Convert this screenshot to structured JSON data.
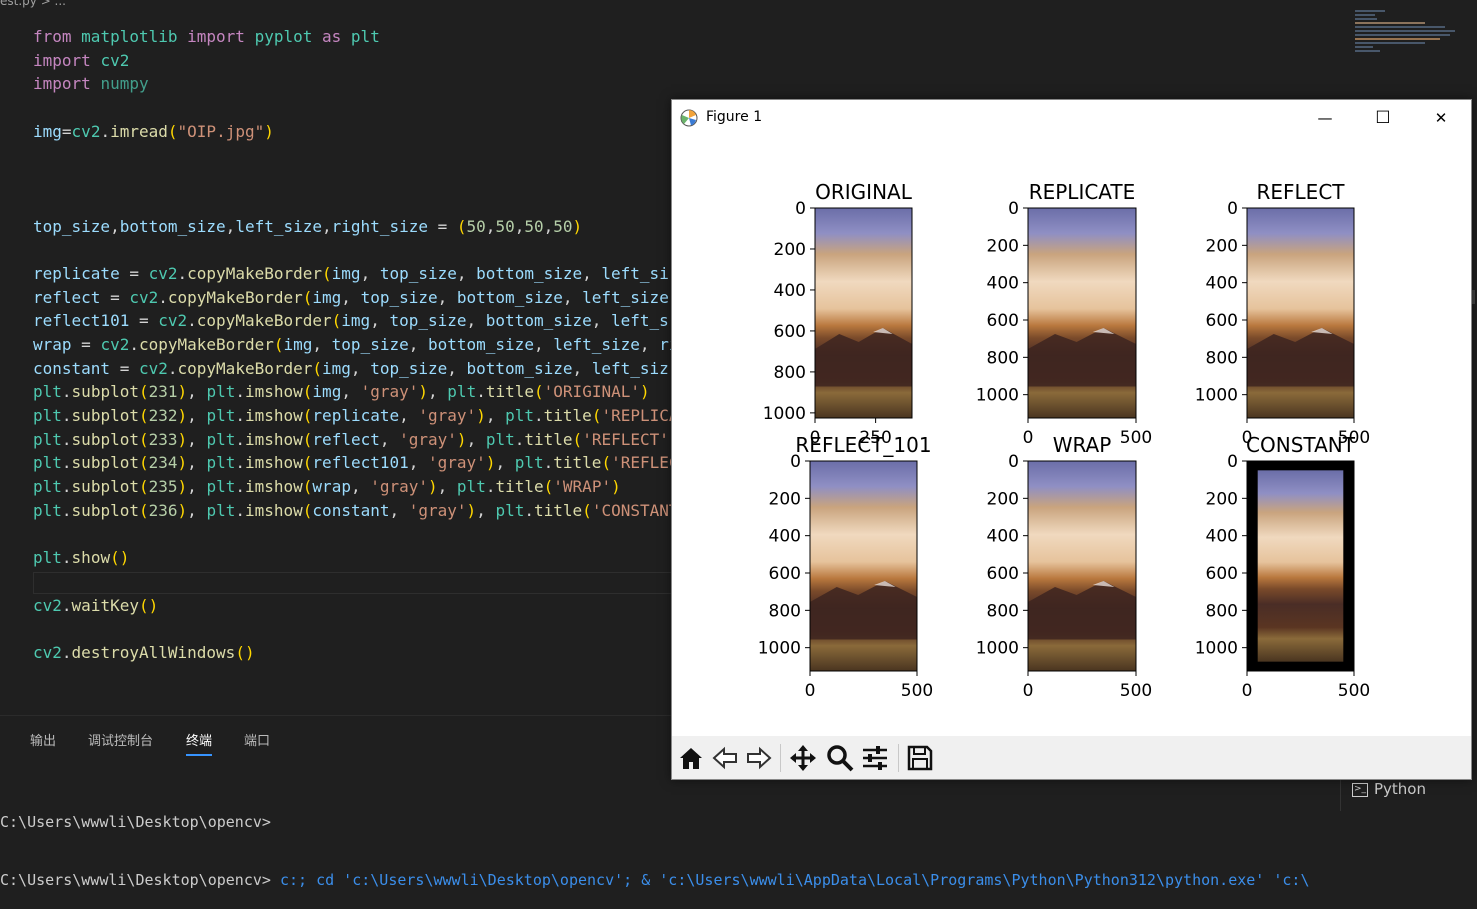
{
  "editor": {
    "breadcrumb": "est.py > ...",
    "code_lines": [
      [
        {
          "t": "from",
          "c": "kw"
        },
        {
          "t": " "
        },
        {
          "t": "matplotlib",
          "c": "mod"
        },
        {
          "t": " "
        },
        {
          "t": "import",
          "c": "kw"
        },
        {
          "t": " "
        },
        {
          "t": "pyplot",
          "c": "mod"
        },
        {
          "t": " "
        },
        {
          "t": "as",
          "c": "kw"
        },
        {
          "t": " "
        },
        {
          "t": "plt",
          "c": "mod"
        }
      ],
      [
        {
          "t": "import",
          "c": "kw"
        },
        {
          "t": " "
        },
        {
          "t": "cv2",
          "c": "mod"
        }
      ],
      [
        {
          "t": "import",
          "c": "kw"
        },
        {
          "t": " "
        },
        {
          "t": "numpy",
          "c": "mod2"
        }
      ],
      [],
      [
        {
          "t": "img",
          "c": "var"
        },
        {
          "t": "="
        },
        {
          "t": "cv2",
          "c": "mod"
        },
        {
          "t": "."
        },
        {
          "t": "imread",
          "c": "fn"
        },
        {
          "t": "(",
          "c": "paren"
        },
        {
          "t": "\"OIP.jpg\"",
          "c": "str"
        },
        {
          "t": ")",
          "c": "paren"
        }
      ],
      [],
      [],
      [],
      [
        {
          "t": "top_size",
          "c": "var"
        },
        {
          "t": ","
        },
        {
          "t": "bottom_size",
          "c": "var"
        },
        {
          "t": ","
        },
        {
          "t": "left_size",
          "c": "var"
        },
        {
          "t": ","
        },
        {
          "t": "right_size",
          "c": "var"
        },
        {
          "t": " = "
        },
        {
          "t": "(",
          "c": "paren"
        },
        {
          "t": "50",
          "c": "num"
        },
        {
          "t": ","
        },
        {
          "t": "50",
          "c": "num"
        },
        {
          "t": ","
        },
        {
          "t": "50",
          "c": "num"
        },
        {
          "t": ","
        },
        {
          "t": "50",
          "c": "num"
        },
        {
          "t": ")",
          "c": "paren"
        }
      ],
      [],
      [
        {
          "t": "replicate",
          "c": "var"
        },
        {
          "t": " = "
        },
        {
          "t": "cv2",
          "c": "mod"
        },
        {
          "t": "."
        },
        {
          "t": "copyMakeBorder",
          "c": "fn"
        },
        {
          "t": "(",
          "c": "paren"
        },
        {
          "t": "img",
          "c": "var"
        },
        {
          "t": ", "
        },
        {
          "t": "top_size",
          "c": "var"
        },
        {
          "t": ", "
        },
        {
          "t": "bottom_size",
          "c": "var"
        },
        {
          "t": ", "
        },
        {
          "t": "left_si",
          "c": "var"
        }
      ],
      [
        {
          "t": "reflect",
          "c": "var"
        },
        {
          "t": " = "
        },
        {
          "t": "cv2",
          "c": "mod"
        },
        {
          "t": "."
        },
        {
          "t": "copyMakeBorder",
          "c": "fn"
        },
        {
          "t": "(",
          "c": "paren"
        },
        {
          "t": "img",
          "c": "var"
        },
        {
          "t": ", "
        },
        {
          "t": "top_size",
          "c": "var"
        },
        {
          "t": ", "
        },
        {
          "t": "bottom_size",
          "c": "var"
        },
        {
          "t": ", "
        },
        {
          "t": "left_size",
          "c": "var"
        }
      ],
      [
        {
          "t": "reflect101",
          "c": "var"
        },
        {
          "t": " = "
        },
        {
          "t": "cv2",
          "c": "mod"
        },
        {
          "t": "."
        },
        {
          "t": "copyMakeBorder",
          "c": "fn"
        },
        {
          "t": "(",
          "c": "paren"
        },
        {
          "t": "img",
          "c": "var"
        },
        {
          "t": ", "
        },
        {
          "t": "top_size",
          "c": "var"
        },
        {
          "t": ", "
        },
        {
          "t": "bottom_size",
          "c": "var"
        },
        {
          "t": ", "
        },
        {
          "t": "left_s",
          "c": "var"
        }
      ],
      [
        {
          "t": "wrap",
          "c": "var"
        },
        {
          "t": " = "
        },
        {
          "t": "cv2",
          "c": "mod"
        },
        {
          "t": "."
        },
        {
          "t": "copyMakeBorder",
          "c": "fn"
        },
        {
          "t": "(",
          "c": "paren"
        },
        {
          "t": "img",
          "c": "var"
        },
        {
          "t": ", "
        },
        {
          "t": "top_size",
          "c": "var"
        },
        {
          "t": ", "
        },
        {
          "t": "bottom_size",
          "c": "var"
        },
        {
          "t": ", "
        },
        {
          "t": "left_size",
          "c": "var"
        },
        {
          "t": ", "
        },
        {
          "t": "ri",
          "c": "var"
        }
      ],
      [
        {
          "t": "constant",
          "c": "var"
        },
        {
          "t": " = "
        },
        {
          "t": "cv2",
          "c": "mod"
        },
        {
          "t": "."
        },
        {
          "t": "copyMakeBorder",
          "c": "fn"
        },
        {
          "t": "(",
          "c": "paren"
        },
        {
          "t": "img",
          "c": "var"
        },
        {
          "t": ", "
        },
        {
          "t": "top_size",
          "c": "var"
        },
        {
          "t": ", "
        },
        {
          "t": "bottom_size",
          "c": "var"
        },
        {
          "t": ", "
        },
        {
          "t": "left_siz",
          "c": "var"
        }
      ],
      [
        {
          "t": "plt",
          "c": "mod"
        },
        {
          "t": "."
        },
        {
          "t": "subplot",
          "c": "fn"
        },
        {
          "t": "(",
          "c": "paren"
        },
        {
          "t": "231",
          "c": "num"
        },
        {
          "t": ")",
          "c": "paren"
        },
        {
          "t": ", "
        },
        {
          "t": "plt",
          "c": "mod"
        },
        {
          "t": "."
        },
        {
          "t": "imshow",
          "c": "fn"
        },
        {
          "t": "(",
          "c": "paren"
        },
        {
          "t": "img",
          "c": "var"
        },
        {
          "t": ", "
        },
        {
          "t": "'gray'",
          "c": "str"
        },
        {
          "t": ")",
          "c": "paren"
        },
        {
          "t": ", "
        },
        {
          "t": "plt",
          "c": "mod"
        },
        {
          "t": "."
        },
        {
          "t": "title",
          "c": "fn"
        },
        {
          "t": "(",
          "c": "paren"
        },
        {
          "t": "'ORIGINAL'",
          "c": "str"
        },
        {
          "t": ")",
          "c": "paren"
        }
      ],
      [
        {
          "t": "plt",
          "c": "mod"
        },
        {
          "t": "."
        },
        {
          "t": "subplot",
          "c": "fn"
        },
        {
          "t": "(",
          "c": "paren"
        },
        {
          "t": "232",
          "c": "num"
        },
        {
          "t": ")",
          "c": "paren"
        },
        {
          "t": ", "
        },
        {
          "t": "plt",
          "c": "mod"
        },
        {
          "t": "."
        },
        {
          "t": "imshow",
          "c": "fn"
        },
        {
          "t": "(",
          "c": "paren"
        },
        {
          "t": "replicate",
          "c": "var"
        },
        {
          "t": ", "
        },
        {
          "t": "'gray'",
          "c": "str"
        },
        {
          "t": ")",
          "c": "paren"
        },
        {
          "t": ", "
        },
        {
          "t": "plt",
          "c": "mod"
        },
        {
          "t": "."
        },
        {
          "t": "title",
          "c": "fn"
        },
        {
          "t": "(",
          "c": "paren"
        },
        {
          "t": "'REPLICA",
          "c": "str"
        }
      ],
      [
        {
          "t": "plt",
          "c": "mod"
        },
        {
          "t": "."
        },
        {
          "t": "subplot",
          "c": "fn"
        },
        {
          "t": "(",
          "c": "paren"
        },
        {
          "t": "233",
          "c": "num"
        },
        {
          "t": ")",
          "c": "paren"
        },
        {
          "t": ", "
        },
        {
          "t": "plt",
          "c": "mod"
        },
        {
          "t": "."
        },
        {
          "t": "imshow",
          "c": "fn"
        },
        {
          "t": "(",
          "c": "paren"
        },
        {
          "t": "reflect",
          "c": "var"
        },
        {
          "t": ", "
        },
        {
          "t": "'gray'",
          "c": "str"
        },
        {
          "t": ")",
          "c": "paren"
        },
        {
          "t": ", "
        },
        {
          "t": "plt",
          "c": "mod"
        },
        {
          "t": "."
        },
        {
          "t": "title",
          "c": "fn"
        },
        {
          "t": "(",
          "c": "paren"
        },
        {
          "t": "'REFLECT'",
          "c": "str"
        }
      ],
      [
        {
          "t": "plt",
          "c": "mod"
        },
        {
          "t": "."
        },
        {
          "t": "subplot",
          "c": "fn"
        },
        {
          "t": "(",
          "c": "paren"
        },
        {
          "t": "234",
          "c": "num"
        },
        {
          "t": ")",
          "c": "paren"
        },
        {
          "t": ", "
        },
        {
          "t": "plt",
          "c": "mod"
        },
        {
          "t": "."
        },
        {
          "t": "imshow",
          "c": "fn"
        },
        {
          "t": "(",
          "c": "paren"
        },
        {
          "t": "reflect101",
          "c": "var"
        },
        {
          "t": ", "
        },
        {
          "t": "'gray'",
          "c": "str"
        },
        {
          "t": ")",
          "c": "paren"
        },
        {
          "t": ", "
        },
        {
          "t": "plt",
          "c": "mod"
        },
        {
          "t": "."
        },
        {
          "t": "title",
          "c": "fn"
        },
        {
          "t": "(",
          "c": "paren"
        },
        {
          "t": "'REFLEC",
          "c": "str"
        }
      ],
      [
        {
          "t": "plt",
          "c": "mod"
        },
        {
          "t": "."
        },
        {
          "t": "subplot",
          "c": "fn"
        },
        {
          "t": "(",
          "c": "paren"
        },
        {
          "t": "235",
          "c": "num"
        },
        {
          "t": ")",
          "c": "paren"
        },
        {
          "t": ", "
        },
        {
          "t": "plt",
          "c": "mod"
        },
        {
          "t": "."
        },
        {
          "t": "imshow",
          "c": "fn"
        },
        {
          "t": "(",
          "c": "paren"
        },
        {
          "t": "wrap",
          "c": "var"
        },
        {
          "t": ", "
        },
        {
          "t": "'gray'",
          "c": "str"
        },
        {
          "t": ")",
          "c": "paren"
        },
        {
          "t": ", "
        },
        {
          "t": "plt",
          "c": "mod"
        },
        {
          "t": "."
        },
        {
          "t": "title",
          "c": "fn"
        },
        {
          "t": "(",
          "c": "paren"
        },
        {
          "t": "'WRAP'",
          "c": "str"
        },
        {
          "t": ")",
          "c": "paren"
        }
      ],
      [
        {
          "t": "plt",
          "c": "mod"
        },
        {
          "t": "."
        },
        {
          "t": "subplot",
          "c": "fn"
        },
        {
          "t": "(",
          "c": "paren"
        },
        {
          "t": "236",
          "c": "num"
        },
        {
          "t": ")",
          "c": "paren"
        },
        {
          "t": ", "
        },
        {
          "t": "plt",
          "c": "mod"
        },
        {
          "t": "."
        },
        {
          "t": "imshow",
          "c": "fn"
        },
        {
          "t": "(",
          "c": "paren"
        },
        {
          "t": "constant",
          "c": "var"
        },
        {
          "t": ", "
        },
        {
          "t": "'gray'",
          "c": "str"
        },
        {
          "t": ")",
          "c": "paren"
        },
        {
          "t": ", "
        },
        {
          "t": "plt",
          "c": "mod"
        },
        {
          "t": "."
        },
        {
          "t": "title",
          "c": "fn"
        },
        {
          "t": "(",
          "c": "paren"
        },
        {
          "t": "'CONSTANT",
          "c": "str"
        }
      ],
      [],
      [
        {
          "t": "plt",
          "c": "mod"
        },
        {
          "t": "."
        },
        {
          "t": "show",
          "c": "fn"
        },
        {
          "t": "()",
          "c": "paren"
        }
      ],
      [],
      [
        {
          "t": "cv2",
          "c": "mod"
        },
        {
          "t": "."
        },
        {
          "t": "waitKey",
          "c": "fn"
        },
        {
          "t": "()",
          "c": "paren"
        }
      ],
      [],
      [
        {
          "t": "cv2",
          "c": "mod"
        },
        {
          "t": "."
        },
        {
          "t": "destroyAllWindows",
          "c": "fn"
        },
        {
          "t": "()",
          "c": "paren"
        }
      ]
    ]
  },
  "panel": {
    "tabs": [
      {
        "label": "输出",
        "x": 30
      },
      {
        "label": "调试控制台",
        "x": 88
      },
      {
        "label": "终端",
        "x": 186,
        "active": true
      },
      {
        "label": "端口",
        "x": 244
      }
    ],
    "terminal_line1": "C:\\Users\\wwwli\\Desktop\\opencv>",
    "terminal_line2_prefix": "C:\\Users\\wwwli\\Desktop\\opencv> ",
    "terminal_line2_cmd": "c:; cd 'c:\\Users\\wwwli\\Desktop\\opencv'; & 'c:\\Users\\wwwli\\AppData\\Local\\Programs\\Python\\Python312\\python.exe' 'c:\\",
    "python_terminal_label": "Python"
  },
  "figure": {
    "title": "Figure 1",
    "minimize_glyph": "—",
    "maximize_glyph": "☐",
    "close_glyph": "✕",
    "toolbar": [
      "home-icon",
      "back-icon",
      "forward-icon",
      "pan-icon",
      "zoom-icon",
      "configure-icon",
      "save-icon"
    ]
  },
  "chart_data": [
    {
      "type": "image",
      "title": "ORIGINAL",
      "yticks": [
        0,
        200,
        400,
        600,
        800,
        1000
      ],
      "xticks": [
        0,
        250
      ],
      "width": 400,
      "height": 1025,
      "border": "none"
    },
    {
      "type": "image",
      "title": "REPLICATE",
      "yticks": [
        0,
        200,
        400,
        600,
        800,
        1000
      ],
      "xticks": [
        0,
        500
      ],
      "width": 500,
      "height": 1125,
      "border": "replicate"
    },
    {
      "type": "image",
      "title": "REFLECT",
      "yticks": [
        0,
        200,
        400,
        600,
        800,
        1000
      ],
      "xticks": [
        0,
        500
      ],
      "width": 500,
      "height": 1125,
      "border": "reflect"
    },
    {
      "type": "image",
      "title": "REFLECT_101",
      "yticks": [
        0,
        200,
        400,
        600,
        800,
        1000
      ],
      "xticks": [
        0,
        500
      ],
      "width": 500,
      "height": 1125,
      "border": "reflect101"
    },
    {
      "type": "image",
      "title": "WRAP",
      "yticks": [
        0,
        200,
        400,
        600,
        800,
        1000
      ],
      "xticks": [
        0,
        500
      ],
      "width": 500,
      "height": 1125,
      "border": "wrap"
    },
    {
      "type": "image",
      "title": "CONSTANT",
      "yticks": [
        0,
        200,
        400,
        600,
        800,
        1000
      ],
      "xticks": [
        0,
        500
      ],
      "width": 500,
      "height": 1125,
      "border": "constant"
    }
  ]
}
